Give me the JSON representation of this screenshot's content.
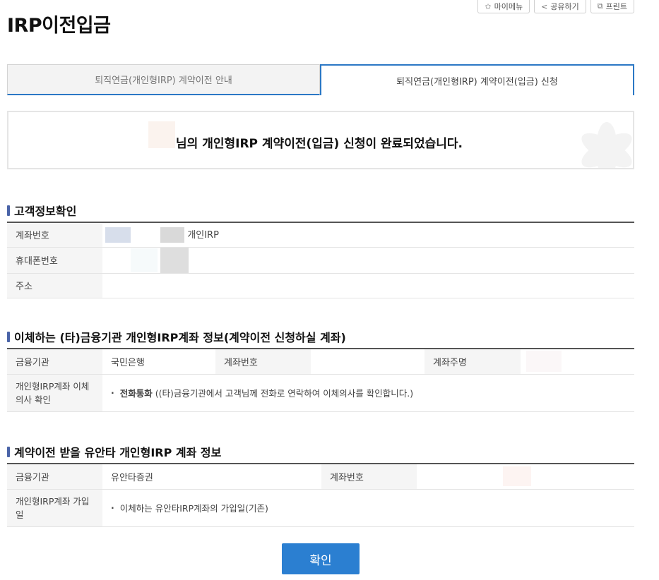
{
  "toolbar": {
    "mymenu": "마이메뉴",
    "share": "공유하기",
    "print": "프린트"
  },
  "page": {
    "title": "IRP이전입금"
  },
  "tabs": [
    {
      "label": "퇴직연금(개인형IRP) 계약이전 안내"
    },
    {
      "label": "퇴직연금(개인형IRP) 계약이전(입금) 신청"
    }
  ],
  "notice": {
    "message": "님의 개인형IRP 계약이전(입금) 신청이 완료되었습니다."
  },
  "customer": {
    "title": "고객정보확인",
    "account_label": "계좌번호",
    "account_suffix": "개인IRP",
    "phone_label": "휴대폰번호",
    "address_label": "주소"
  },
  "from_account": {
    "title": "이체하는 (타)금융기관 개인형IRP계좌 정보(계약이전 신청하실 계좌)",
    "institution_label": "금융기관",
    "institution_value": "국민은행",
    "account_label": "계좌번호",
    "holder_label": "계좌주명",
    "intent_label": "개인형IRP계좌 이체의사 확인",
    "intent_method": "전화통화",
    "intent_desc": " ((타)금융기관에서 고객님께 전화로 연락하여 이체의사를 확인합니다.)"
  },
  "to_account": {
    "title": "계약이전 받을 유안타 개인형IRP 계좌 정보",
    "institution_label": "금융기관",
    "institution_value": "유안타증권",
    "account_label": "계좌번호",
    "join_label": "개인형IRP계좌 가입일",
    "join_desc": "이체하는 유안타IRP계좌의 가입일(기존)"
  },
  "confirm_label": "확인",
  "icons": {
    "mymenu": "star-icon",
    "share": "share-icon",
    "print": "copy-icon"
  }
}
